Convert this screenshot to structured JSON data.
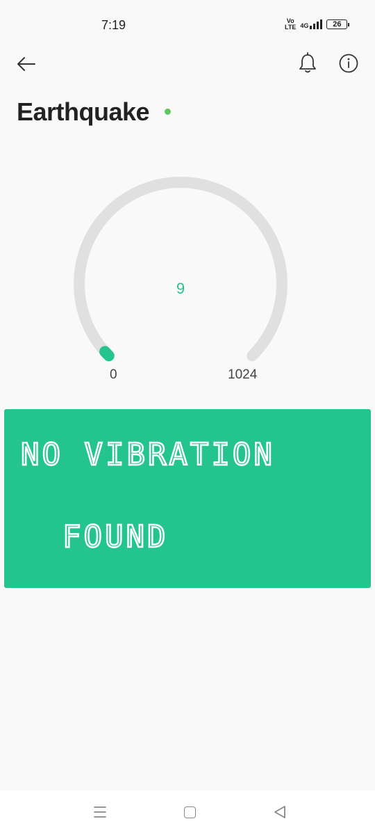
{
  "status_bar": {
    "time": "7:19",
    "volte_top": "Vo",
    "volte_bottom": "LTE",
    "network": "4G",
    "battery_level": "26"
  },
  "app_bar": {
    "back_icon": "back-arrow-icon",
    "bell_icon": "bell-icon",
    "info_icon": "info-icon"
  },
  "device": {
    "title": "Earthquake",
    "status_color": "#5fc75f"
  },
  "gauge": {
    "value": "9",
    "min": "0",
    "max": "1024",
    "fraction": 0.0088,
    "accent_color": "#23c48e",
    "track_color": "#e0e0e0"
  },
  "lcd": {
    "line1": "NO VIBRATION",
    "line2": "FOUND",
    "background": "#23c48e"
  },
  "nav_bar": {
    "menu_icon": "menu-icon",
    "home_icon": "home-square-icon",
    "back_icon": "back-triangle-icon"
  }
}
